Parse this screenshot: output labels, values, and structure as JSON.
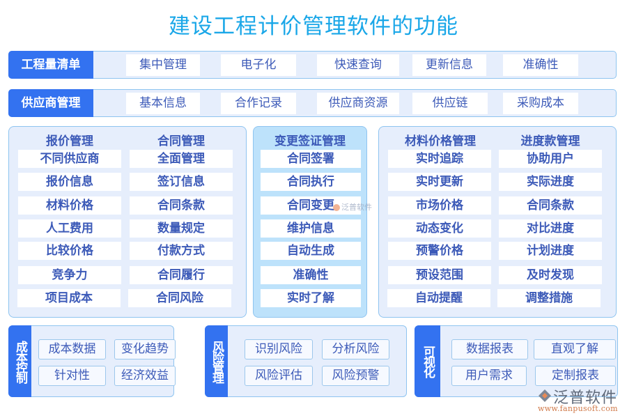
{
  "title": "建设工程计价管理软件的功能",
  "rows": [
    {
      "label": "工程量清单",
      "items": [
        "集中管理",
        "电子化",
        "快速查询",
        "更新信息",
        "准确性"
      ]
    },
    {
      "label": "供应商管理",
      "items": [
        "基本信息",
        "合作记录",
        "供应商资源",
        "供应链",
        "采购成本"
      ]
    }
  ],
  "panels": {
    "left": {
      "columns": [
        {
          "title": "报价管理",
          "items": [
            "不同供应商",
            "报价信息",
            "材料价格",
            "人工费用",
            "比较价格",
            "竞争力",
            "项目成本"
          ]
        },
        {
          "title": "合同管理",
          "items": [
            "全面管理",
            "签订信息",
            "合同条款",
            "数量规定",
            "付款方式",
            "合同履行",
            "合同风险"
          ]
        }
      ]
    },
    "middle": {
      "title": "变更签证管理",
      "items": [
        "合同签署",
        "合同执行",
        "合同变更",
        "维护信息",
        "自动生成",
        "准确性",
        "实时了解"
      ]
    },
    "right": {
      "columns": [
        {
          "title": "材料价格管理",
          "items": [
            "实时追踪",
            "实时更新",
            "市场价格",
            "动态变化",
            "预警价格",
            "预设范围",
            "自动提醒"
          ]
        },
        {
          "title": "进度款管理",
          "items": [
            "协助用户",
            "实际进度",
            "合同条款",
            "对比进度",
            "计划进度",
            "及时发现",
            "调整措施"
          ]
        }
      ]
    }
  },
  "bottom": [
    {
      "label": "成本控制",
      "items": [
        "成本数据",
        "变化趋势",
        "针对性",
        "经济效益"
      ]
    },
    {
      "label": "风险管理",
      "items": [
        "识别风险",
        "分析风险",
        "风险评估",
        "风险预警"
      ]
    },
    {
      "label": "可视化",
      "items": [
        "数据报表",
        "直观了解",
        "用户需求",
        "定制报表"
      ]
    }
  ],
  "watermark": {
    "center_text": "泛普软件",
    "logo_name": "泛普软件",
    "logo_url": "www.fanpusoft.com"
  },
  "colors": {
    "title": "#1aa7e8",
    "label_bg": "#3372f0",
    "panel_bg": "#e6eefc",
    "middle_panel_bg": "#bde2fb",
    "item_text": "#3c5ab8",
    "border": "#8ec4f0"
  }
}
